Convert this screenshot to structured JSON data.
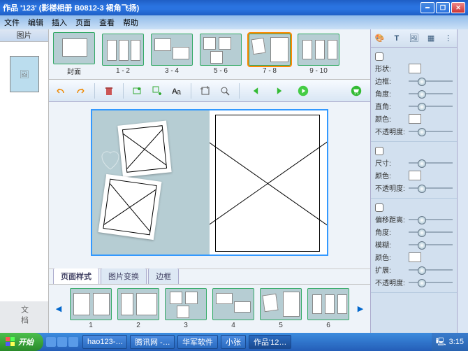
{
  "window": {
    "title": "作品 '123' (影楼相册 B0812-3 裙角飞扬)"
  },
  "menu": [
    "文件",
    "编辑",
    "插入",
    "页面",
    "查看",
    "帮助"
  ],
  "left_panel": {
    "header": "图片",
    "side_label": "文档"
  },
  "top_templates": [
    {
      "caption": "封面"
    },
    {
      "caption": "1 - 2"
    },
    {
      "caption": "3 - 4"
    },
    {
      "caption": "5 - 6"
    },
    {
      "caption": "7 - 8",
      "selected": true
    },
    {
      "caption": "9 - 10"
    }
  ],
  "style_tabs": [
    {
      "label": "页面样式",
      "active": true
    },
    {
      "label": "图片变换",
      "active": false
    },
    {
      "label": "边框",
      "active": false
    }
  ],
  "bottom_templates": [
    {
      "caption": "1"
    },
    {
      "caption": "2"
    },
    {
      "caption": "3"
    },
    {
      "caption": "4"
    },
    {
      "caption": "5"
    },
    {
      "caption": "6"
    }
  ],
  "props": {
    "group1": {
      "shape": "形状:",
      "border": "边框:",
      "angle": "角度:",
      "radius": "直角:",
      "color": "颜色:",
      "opacity": "不透明度:"
    },
    "group2": {
      "size": "尺寸:",
      "color": "颜色:",
      "opacity": "不透明度:"
    },
    "group3": {
      "offset": "偏移距离:",
      "angle": "角度:",
      "blur": "模糊:",
      "color": "颜色:",
      "expand": "扩展:",
      "opacity": "不透明度:"
    }
  },
  "taskbar": {
    "start": "开始",
    "items": [
      "hao123-…",
      "腾讯网 -…",
      "华军软件",
      "小张",
      "作品'12…"
    ],
    "time": "3:15"
  }
}
